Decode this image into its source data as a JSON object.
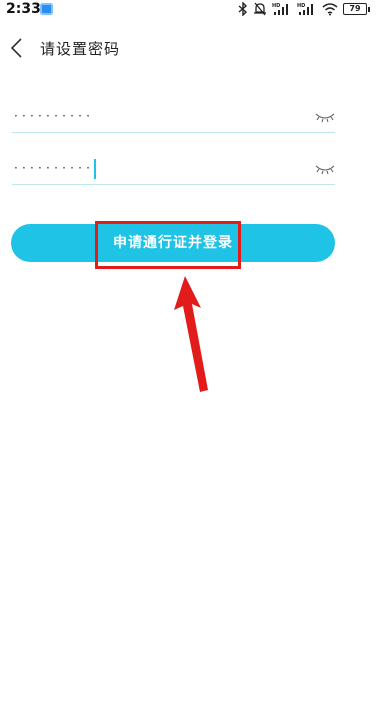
{
  "status_bar": {
    "time": "2:33",
    "battery_level": "79",
    "icons": [
      "app-notification-icon",
      "bluetooth-icon",
      "mute-icon",
      "hd-signal-icon",
      "hd-signal-icon",
      "wifi-icon",
      "battery-icon"
    ]
  },
  "header": {
    "title": "请设置密码",
    "back_icon": "chevron-left-icon"
  },
  "form": {
    "password_field": {
      "value": "··········",
      "toggle_icon": "eye-closed-icon"
    },
    "confirm_field": {
      "value": "··········",
      "toggle_icon": "eye-closed-icon"
    },
    "submit_label": "申请通行证并登录"
  },
  "annotation": {
    "highlight_color": "#e21b1b",
    "arrow_color": "#e21b1b"
  },
  "colors": {
    "accent": "#1ec3e5",
    "field_underline": "#bfe6ec"
  }
}
